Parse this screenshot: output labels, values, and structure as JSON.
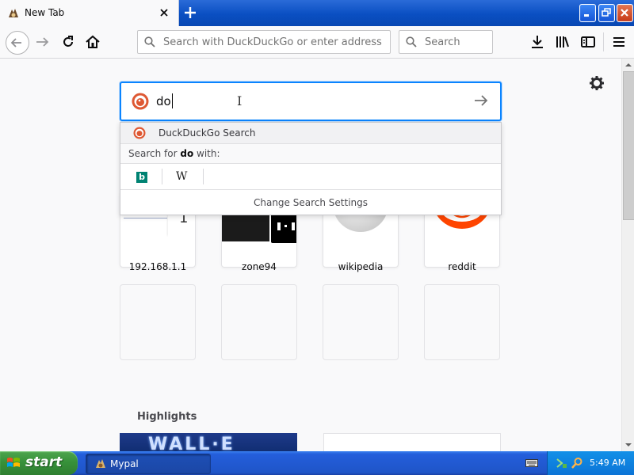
{
  "tab": {
    "title": "New Tab",
    "new_tab_symbol": "+"
  },
  "toolbar": {
    "url_placeholder": "Search with DuckDuckGo or enter address",
    "search_placeholder": "Search"
  },
  "search": {
    "value": "do",
    "dropdown": {
      "engine_label": "DuckDuckGo Search",
      "search_for_prefix": "Search for ",
      "search_for_term": "do",
      "search_for_suffix": " with:",
      "engines": [
        {
          "name": "bing-icon",
          "glyph": "b"
        },
        {
          "name": "wikipedia-icon",
          "glyph": "W"
        }
      ],
      "change_settings": "Change Search Settings"
    }
  },
  "top_sites": [
    {
      "label": "192.168.1.1",
      "badge": "1"
    },
    {
      "label": "zone94"
    },
    {
      "label": "wikipedia"
    },
    {
      "label": "reddit"
    }
  ],
  "highlights": {
    "title": "Highlights",
    "card1_text": "WALL·E"
  },
  "taskbar": {
    "start_label": "start",
    "task_label": "Mypal",
    "clock": "5:49 AM"
  },
  "colors": {
    "focus_blue": "#0a84ff",
    "reddit_orange": "#ff4500",
    "bing_teal": "#008373",
    "xp_green": "#37913a"
  }
}
